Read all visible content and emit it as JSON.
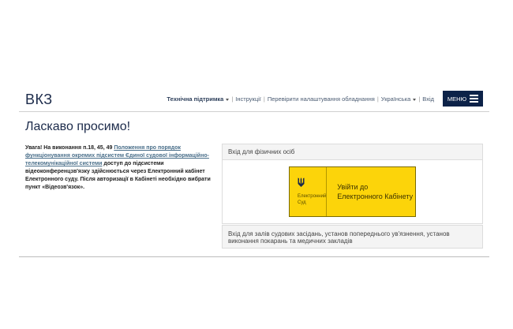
{
  "header": {
    "logo": "ВКЗ",
    "nav": [
      {
        "label": "Технічна підтримка",
        "dropdown": true,
        "bold": true
      },
      {
        "label": "Інструкції",
        "dropdown": false,
        "bold": false
      },
      {
        "label": "Перевірити налаштування обладнання",
        "dropdown": false,
        "bold": false
      },
      {
        "label": "Українська",
        "dropdown": true,
        "bold": false
      },
      {
        "label": "Вхід",
        "dropdown": false,
        "bold": false
      }
    ],
    "menu_label": "МЕНЮ"
  },
  "main": {
    "welcome": "Ласкаво просимо!",
    "notice": {
      "prefix": "Увага! На виконання п.18, 45, 49 ",
      "link": "Положення про порядок функціонування окремих підсистем Єдиної судової інформаційно-телекомунікаційної системи",
      "suffix": " доступ до підсистеми відеоконференцзв'язку здійснюється через Електронний кабінет Електронного суду. Після авторизації в Кабінеті необхідно вибрати пункт «Відеозв'язок»."
    },
    "individuals_panel": {
      "title": "Вхід для фізичних осіб",
      "button": {
        "brand": "Електронний Суд",
        "text": "Увійти до Електронного Кабінету"
      }
    },
    "courtrooms_panel": {
      "title": "Вхід для залів судових засідань, установ попереднього ув'язнення, установ виконання покарань та медичних закладів"
    }
  },
  "colors": {
    "brand_dark": "#0c2248",
    "button_yellow": "#fcd40a",
    "link": "#4a6f8a"
  },
  "icons": {
    "menu": "hamburger-icon",
    "court": "trident-icon"
  }
}
